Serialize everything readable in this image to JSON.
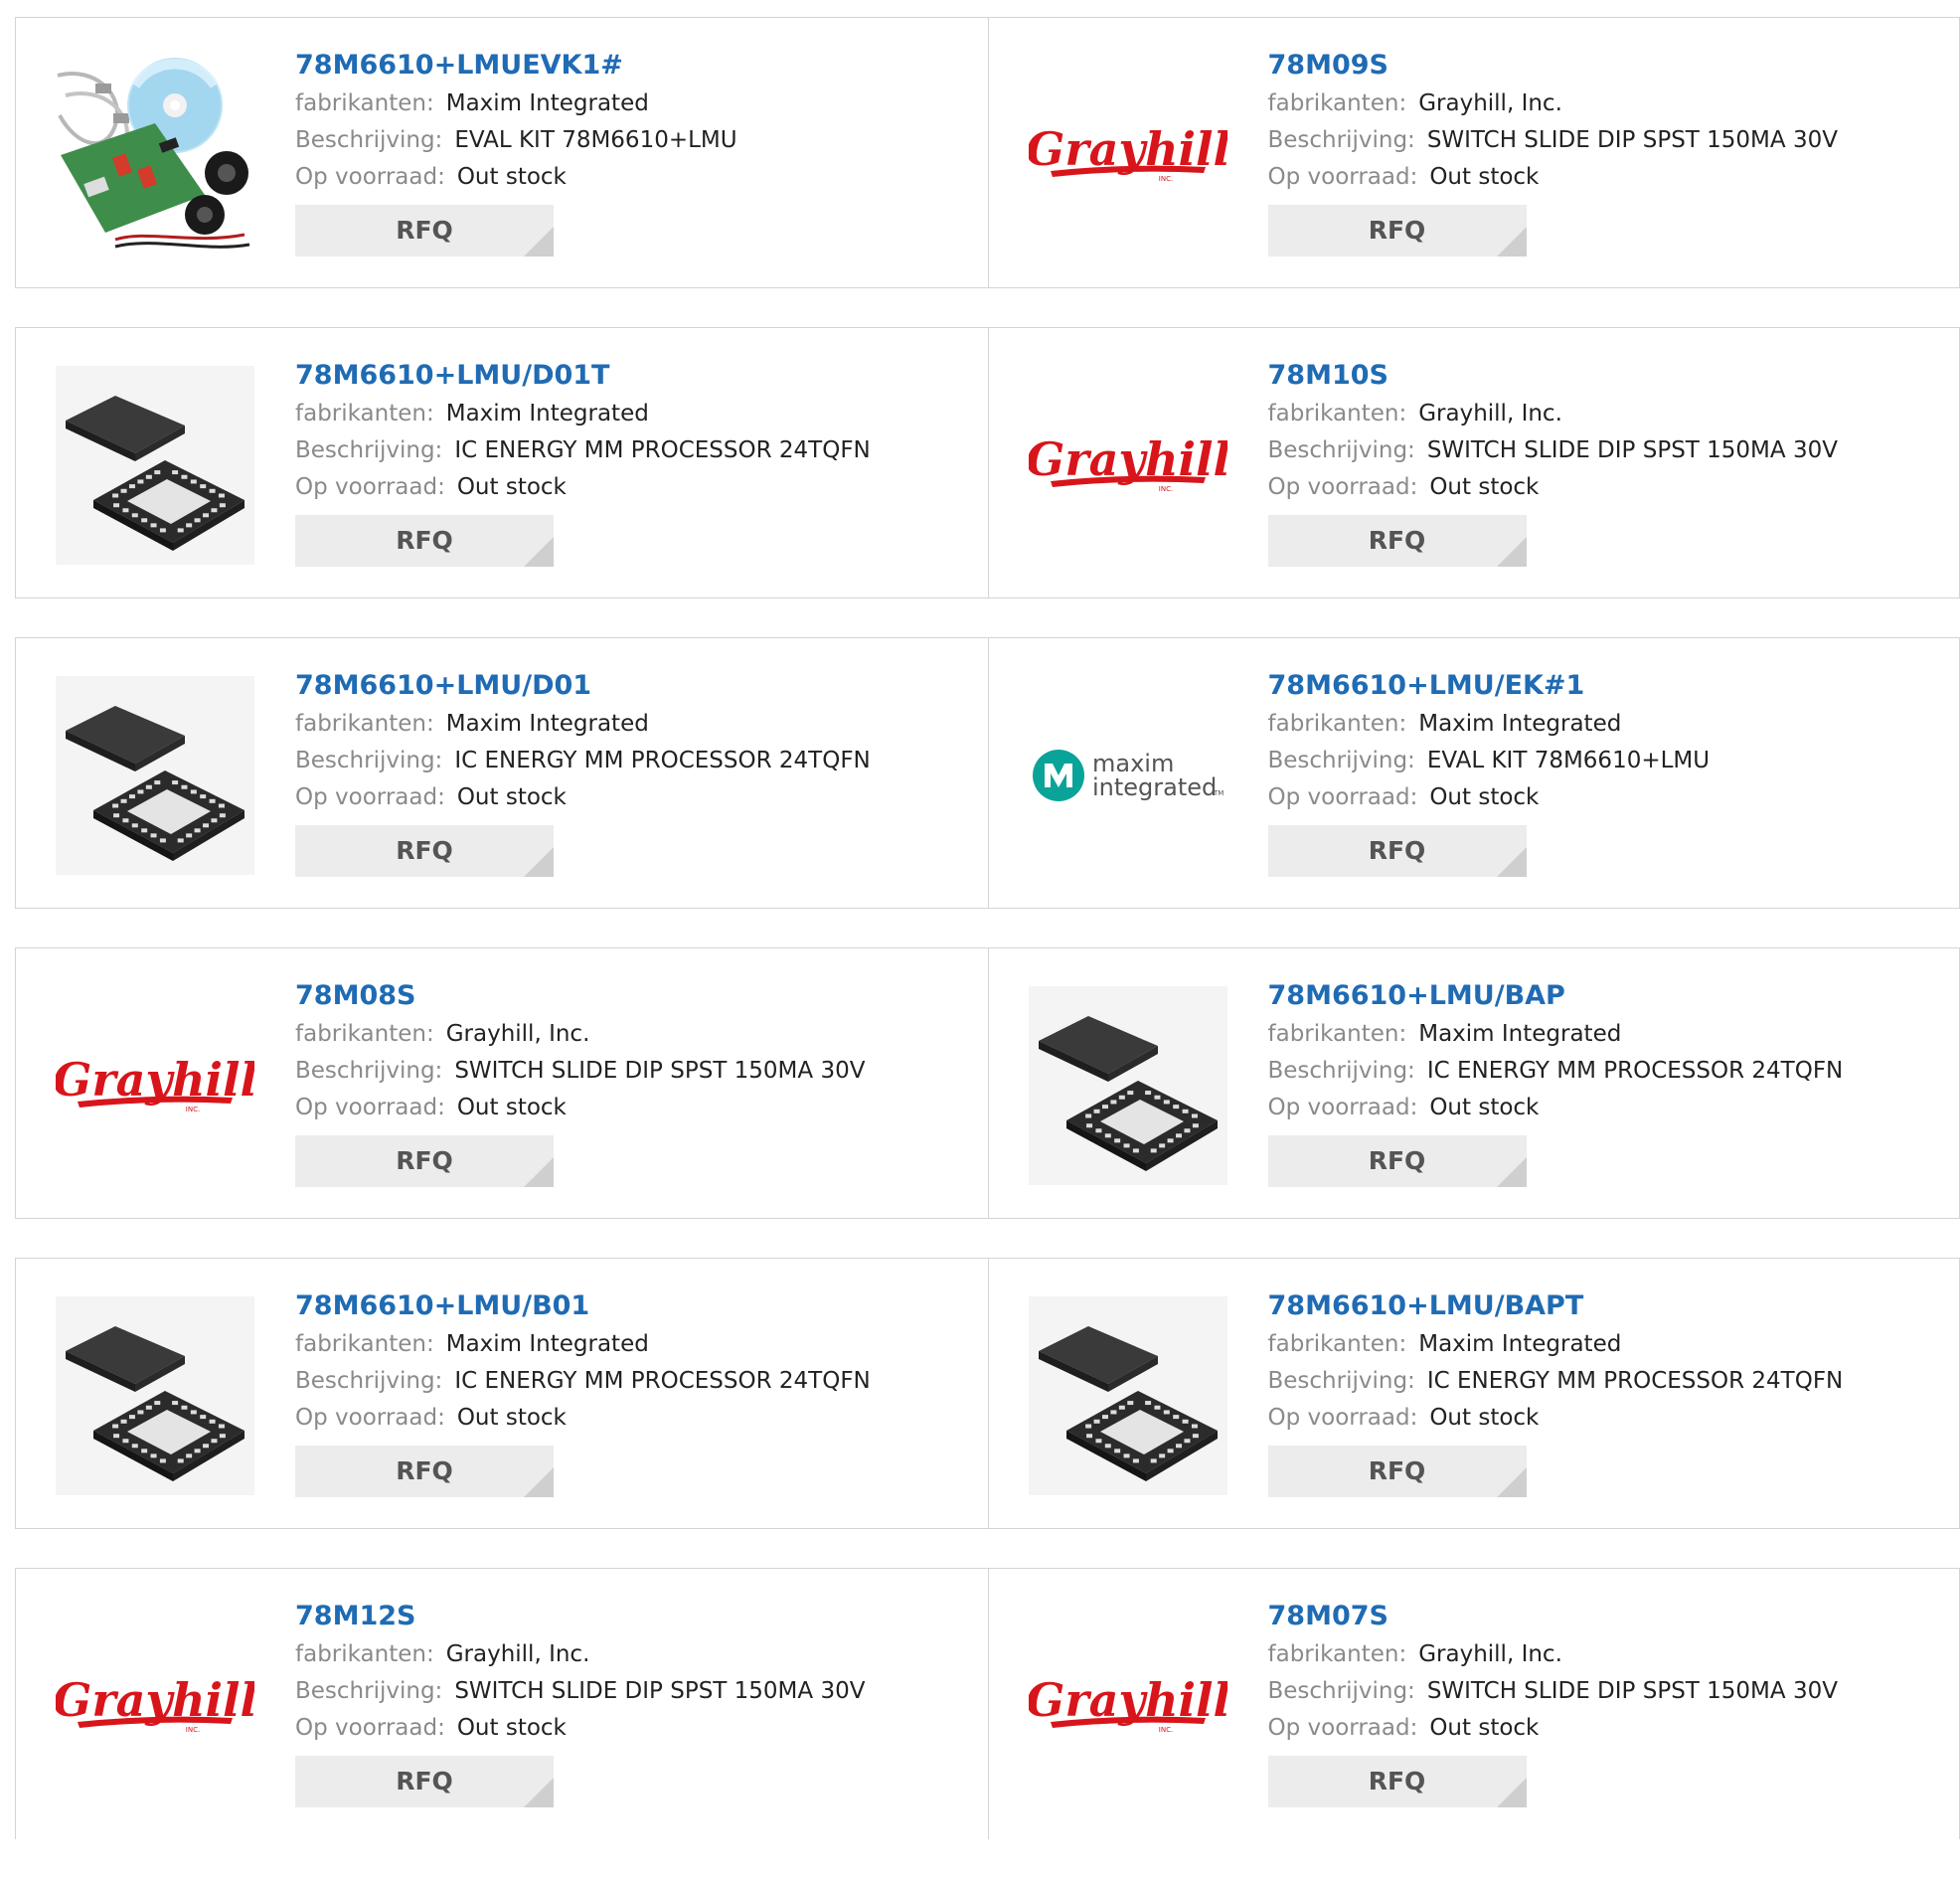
{
  "labels": {
    "manufacturer": "fabrikanten:",
    "description": "Beschrijving:",
    "stock": "Op voorraad:",
    "rfq": "RFQ"
  },
  "brand_colors": {
    "part_link": "#1f6bb4",
    "grayhill_red": "#d8151b",
    "maxim_teal": "#0aa39a"
  },
  "grayhill_logo": {
    "word": "Grayhill",
    "sub": "INC."
  },
  "maxim_logo": {
    "line1": "maxim",
    "line2": "integrated",
    "tm": "TM"
  },
  "rows": [
    {
      "cards": [
        {
          "part": "78M6610+LMUEVK1#",
          "manufacturer": "Maxim Integrated",
          "description": "EVAL KIT 78M6610+LMU",
          "stock": "Out stock",
          "image": "eval-kit"
        },
        {
          "part": "78M09S",
          "manufacturer": "Grayhill, Inc.",
          "description": "SWITCH SLIDE DIP SPST 150MA 30V",
          "stock": "Out stock",
          "image": "grayhill"
        }
      ]
    },
    {
      "cards": [
        {
          "part": "78M6610+LMU/D01T",
          "manufacturer": "Maxim Integrated",
          "description": "IC ENERGY MM PROCESSOR 24TQFN",
          "stock": "Out stock",
          "image": "chip"
        },
        {
          "part": "78M10S",
          "manufacturer": "Grayhill, Inc.",
          "description": "SWITCH SLIDE DIP SPST 150MA 30V",
          "stock": "Out stock",
          "image": "grayhill"
        }
      ]
    },
    {
      "cards": [
        {
          "part": "78M6610+LMU/D01",
          "manufacturer": "Maxim Integrated",
          "description": "IC ENERGY MM PROCESSOR 24TQFN",
          "stock": "Out stock",
          "image": "chip"
        },
        {
          "part": "78M6610+LMU/EK#1",
          "manufacturer": "Maxim Integrated",
          "description": "EVAL KIT 78M6610+LMU",
          "stock": "Out stock",
          "image": "maxim"
        }
      ]
    },
    {
      "cards": [
        {
          "part": "78M08S",
          "manufacturer": "Grayhill, Inc.",
          "description": "SWITCH SLIDE DIP SPST 150MA 30V",
          "stock": "Out stock",
          "image": "grayhill"
        },
        {
          "part": "78M6610+LMU/BAP",
          "manufacturer": "Maxim Integrated",
          "description": "IC ENERGY MM PROCESSOR 24TQFN",
          "stock": "Out stock",
          "image": "chip"
        }
      ]
    },
    {
      "cards": [
        {
          "part": "78M6610+LMU/B01",
          "manufacturer": "Maxim Integrated",
          "description": "IC ENERGY MM PROCESSOR 24TQFN",
          "stock": "Out stock",
          "image": "chip"
        },
        {
          "part": "78M6610+LMU/BAPT",
          "manufacturer": "Maxim Integrated",
          "description": "IC ENERGY MM PROCESSOR 24TQFN",
          "stock": "Out stock",
          "image": "chip"
        }
      ]
    },
    {
      "cards": [
        {
          "part": "78M12S",
          "manufacturer": "Grayhill, Inc.",
          "description": "SWITCH SLIDE DIP SPST 150MA 30V",
          "stock": "Out stock",
          "image": "grayhill"
        },
        {
          "part": "78M07S",
          "manufacturer": "Grayhill, Inc.",
          "description": "SWITCH SLIDE DIP SPST 150MA 30V",
          "stock": "Out stock",
          "image": "grayhill"
        }
      ]
    }
  ]
}
